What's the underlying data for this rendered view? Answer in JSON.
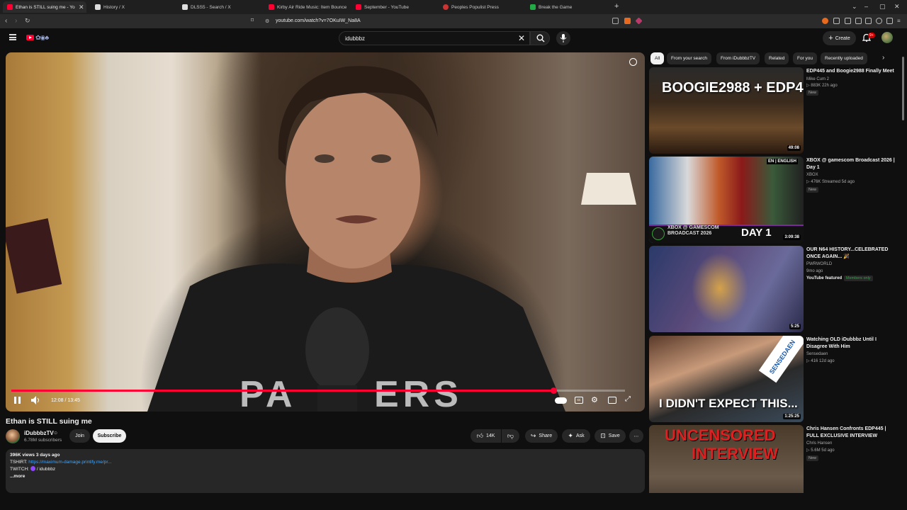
{
  "browser": {
    "tabs": [
      {
        "title": "Ethan is STILL suing me - Yo",
        "color": "#ff0033",
        "active": true
      },
      {
        "title": "History / X",
        "color": "#dddddd"
      },
      {
        "title": "DLSS5 - Search / X",
        "color": "#dddddd"
      },
      {
        "title": "Kirby Air Ride Music: Item Bounce",
        "color": "#ff0033"
      },
      {
        "title": "September - YouTube",
        "color": "#ff0033"
      },
      {
        "title": "Peoples Populist Press",
        "color": "#cc3333"
      },
      {
        "title": "Break the Game",
        "color": "#22aa44"
      }
    ],
    "url": "youtube.com/watch?v=7OKuIW_Na8A"
  },
  "header": {
    "search_value": "idubbbz",
    "create_label": "Create",
    "notification_badge": "9+"
  },
  "video": {
    "current_time": "12:08",
    "duration": "13:45",
    "time_display": "12:08 / 13:45",
    "progress": 0.883,
    "title": "Ethan is STILL suing me"
  },
  "channel": {
    "name": "iDubbbzTV",
    "subscribers": "6.78M subscribers",
    "join_label": "Join",
    "subscribe_label": "Subscribe"
  },
  "actions": {
    "likes": "14K",
    "share_label": "Share",
    "ask_label": "Ask",
    "save_label": "Save"
  },
  "description": {
    "stats": "396K views  3 days ago",
    "tshirt_label": "TSHIRT:",
    "tshirt_link": "https://maximum-damage.printify.me/pr...",
    "twitch_label": "TWITCH:",
    "twitch_link": "/ idubbbz",
    "more_label": "...more"
  },
  "chips": [
    "All",
    "From your search",
    "From iDubbbzTV",
    "Related",
    "For you",
    "Recently uploaded"
  ],
  "recommendations": [
    {
      "title": "EDP445 and Boogie2988 Finally Meet",
      "channel": "Mike Cum 2",
      "meta": "▷ 883K  22h ago",
      "badge": "New",
      "duration": "49:08",
      "thumb_text": "BOOGIE2988 + EDP445"
    },
    {
      "title": "XBOX @ gamescom Broadcast 2026 | Day 1",
      "channel": "XBOX",
      "meta": "▷ 476K  Streamed 5d ago",
      "badge": "New",
      "duration": "3:09:38",
      "thumb_text": "XBOX @ GAMESCOM BROADCAST 2026",
      "thumb_text2": "DAY 1",
      "thumb_lang": "EN | ENGLISH"
    },
    {
      "title": "OUR N64 HISTORY...CELEBRATED ONCE AGAIN... 🎉",
      "channel": "PWRWORLD",
      "meta": "9mo ago",
      "extra": "YouTube featured",
      "extra2": "Members only",
      "duration": "5:25"
    },
    {
      "title": "Watching OLD iDubbbz Until I Disagree With Him",
      "channel": "Sensedaen",
      "meta": "▷ 416  12d ago",
      "duration": "1:25:25",
      "thumb_text": "I DIDN'T EXPECT THIS...",
      "thumb_text2": "SENSEDAEN"
    },
    {
      "title": "Chris Hansen Confronts EDP445 | FULL EXCLUSIVE INTERVIEW",
      "channel": "Chris Hansen",
      "meta": "▷ 5.6M  5d ago",
      "badge": "New",
      "thumb_text": "UNCENSORED",
      "thumb_text2": "INTERVIEW"
    }
  ]
}
